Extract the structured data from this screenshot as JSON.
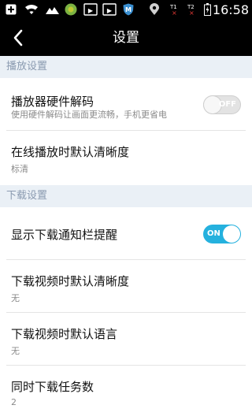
{
  "status_bar": {
    "time": "16:58",
    "icons": [
      "add-icon",
      "wifi-icon",
      "cloud-icon",
      "app-icon",
      "video-icon",
      "video-icon",
      "shield-icon",
      "location-icon",
      "signal-1-icon",
      "signal-2-icon",
      "battery-icon"
    ],
    "sim1_label": "T1",
    "sim2_label": "T2"
  },
  "nav": {
    "title": "设置",
    "back_icon": "chevron-left-icon"
  },
  "sections": [
    {
      "title": "播放设置",
      "items": [
        {
          "title": "播放器硬件解码",
          "subtitle": "使用硬件解码让画面更流畅，手机更省电",
          "toggle": "off",
          "toggle_label": "OFF"
        },
        {
          "title": "在线播放时默认清晰度",
          "subtitle": "标清"
        }
      ]
    },
    {
      "title": "下载设置",
      "items": [
        {
          "title": "显示下载通知栏提醒",
          "toggle": "on",
          "toggle_label": "ON"
        },
        {
          "title": "下载视频时默认清晰度",
          "subtitle": "无"
        },
        {
          "title": "下载视频时默认语言",
          "subtitle": "无"
        },
        {
          "title": "同时下载任务数",
          "subtitle": "2"
        }
      ]
    }
  ],
  "colors": {
    "accent": "#25b1de",
    "section_bg": "#eaf0f6",
    "section_text": "#8a9ab0",
    "bar_bg": "#000000"
  }
}
